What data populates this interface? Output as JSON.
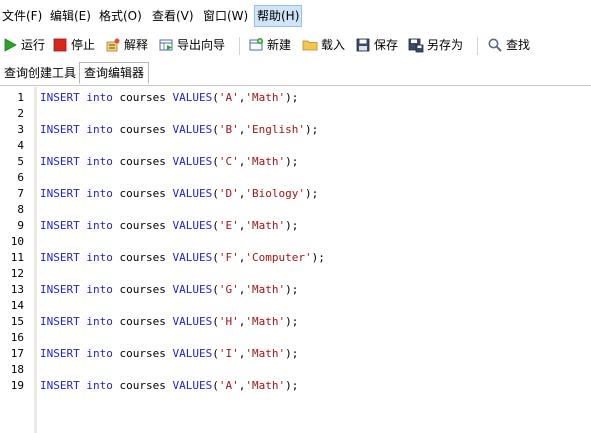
{
  "menu": {
    "items": [
      {
        "label": "文件(F)"
      },
      {
        "label": "编辑(E)"
      },
      {
        "label": "格式(O)"
      },
      {
        "label": "查看(V)"
      },
      {
        "label": "窗口(W)"
      },
      {
        "label": "帮助(H)"
      }
    ]
  },
  "toolbar": {
    "run": "运行",
    "stop": "停止",
    "explain": "解释",
    "export_wizard": "导出向导",
    "new": "新建",
    "load": "载入",
    "save": "保存",
    "save_as": "另存为",
    "find": "查找"
  },
  "tabs": [
    {
      "label": "查询创建工具"
    },
    {
      "label": "查询编辑器"
    }
  ],
  "editor": {
    "lines": [
      {
        "num": "1",
        "kw1": "INSERT",
        "kw2": "into",
        "table": "courses",
        "kw3": "VALUES",
        "v1": "'A'",
        "v2": "'Math'"
      },
      {
        "num": "2"
      },
      {
        "num": "3",
        "kw1": "INSERT",
        "kw2": "into",
        "table": "courses",
        "kw3": "VALUES",
        "v1": "'B'",
        "v2": "'English'"
      },
      {
        "num": "4"
      },
      {
        "num": "5",
        "kw1": "INSERT",
        "kw2": "into",
        "table": "courses",
        "kw3": "VALUES",
        "v1": "'C'",
        "v2": "'Math'"
      },
      {
        "num": "6"
      },
      {
        "num": "7",
        "kw1": "INSERT",
        "kw2": "into",
        "table": "courses",
        "kw3": "VALUES",
        "v1": "'D'",
        "v2": "'Biology'"
      },
      {
        "num": "8"
      },
      {
        "num": "9",
        "kw1": "INSERT",
        "kw2": "into",
        "table": "courses",
        "kw3": "VALUES",
        "v1": "'E'",
        "v2": "'Math'"
      },
      {
        "num": "10"
      },
      {
        "num": "11",
        "kw1": "INSERT",
        "kw2": "into",
        "table": "courses",
        "kw3": "VALUES",
        "v1": "'F'",
        "v2": "'Computer'"
      },
      {
        "num": "12"
      },
      {
        "num": "13",
        "kw1": "INSERT",
        "kw2": "into",
        "table": "courses",
        "kw3": "VALUES",
        "v1": "'G'",
        "v2": "'Math'"
      },
      {
        "num": "14"
      },
      {
        "num": "15",
        "kw1": "INSERT",
        "kw2": "into",
        "table": "courses",
        "kw3": "VALUES",
        "v1": "'H'",
        "v2": "'Math'"
      },
      {
        "num": "16"
      },
      {
        "num": "17",
        "kw1": "INSERT",
        "kw2": "into",
        "table": "courses",
        "kw3": "VALUES",
        "v1": "'I'",
        "v2": "'Math'"
      },
      {
        "num": "18"
      },
      {
        "num": "19",
        "kw1": "INSERT",
        "kw2": "into",
        "table": "courses",
        "kw3": "VALUES",
        "v1": "'A'",
        "v2": "'Math'"
      }
    ]
  },
  "colors": {
    "keyword": "#1f1fd8",
    "string": "#a31515",
    "menu_active_bg": "#cfe4f7"
  }
}
